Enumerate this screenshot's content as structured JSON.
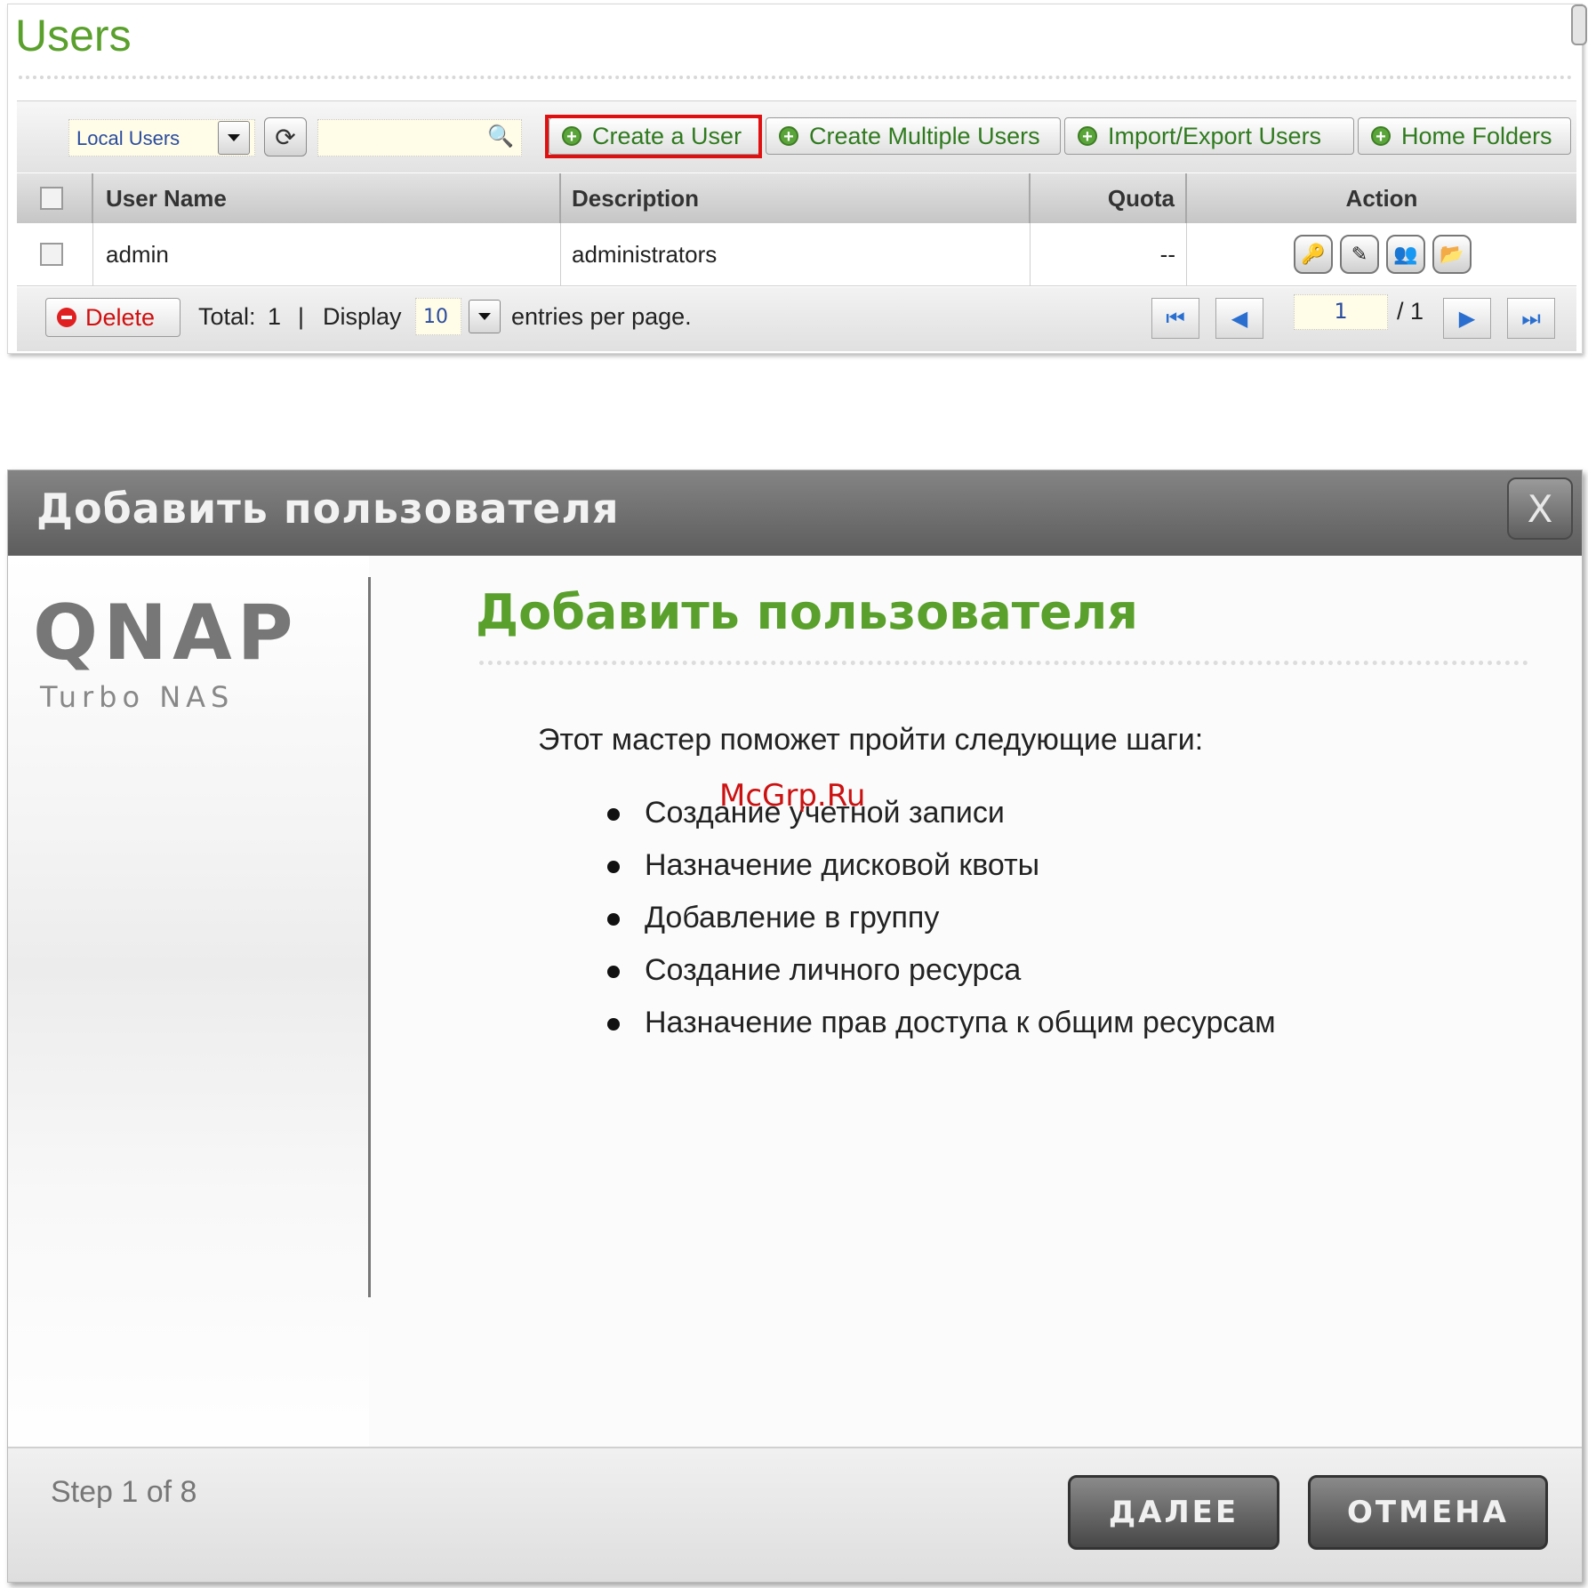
{
  "users_panel": {
    "title": "Users",
    "filter": {
      "selected": "Local Users"
    },
    "toolbar": {
      "create_user": "Create a User",
      "create_multiple": "Create Multiple Users",
      "import_export": "Import/Export Users",
      "home_folders": "Home Folders"
    },
    "columns": [
      "User Name",
      "Description",
      "Quota",
      "Action"
    ],
    "rows": [
      {
        "user_name": "admin",
        "description": "administrators",
        "quota": "--"
      }
    ],
    "footer": {
      "delete": "Delete",
      "total_label": "Total:",
      "total_value": "1",
      "separator": "|",
      "display_label": "Display",
      "per_page": "10",
      "entries_label": "entries per page.",
      "page": "1",
      "page_total": "/ 1"
    }
  },
  "dialog": {
    "title": "Добавить пользователя",
    "close": "X",
    "logo": "QNAP",
    "logo_sub": "Turbo NAS",
    "heading": "Добавить пользователя",
    "intro": "Этот мастер поможет пройти следующие шаги:",
    "steps": [
      "Создание учетной записи",
      "Назначение дисковой квоты",
      "Добавление в группу",
      "Создание личного ресурса",
      "Назначение прав доступа к общим ресурсам"
    ],
    "watermark": "McGrp.Ru",
    "step_indicator": "Step 1 of 8",
    "next": "ДАЛЕЕ",
    "cancel": "ОТМЕНА"
  },
  "colors": {
    "accent_green": "#5aa02c",
    "highlight_red": "#e01010",
    "dialog_header": "#6e6e6e"
  }
}
